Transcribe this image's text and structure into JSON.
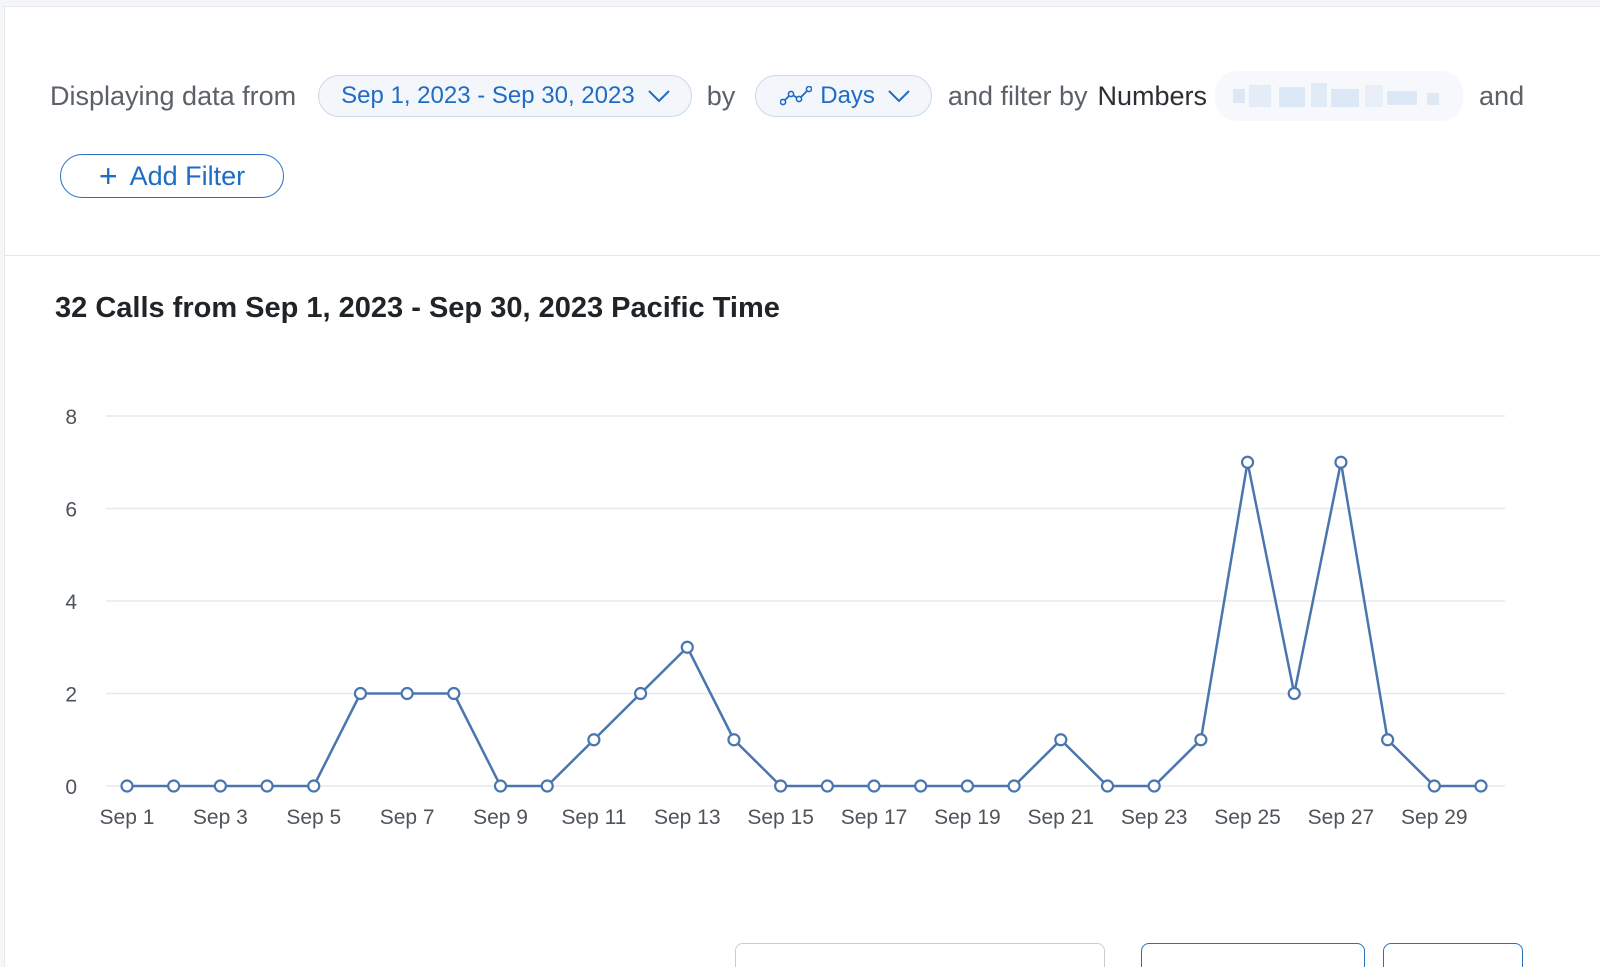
{
  "filter_bar": {
    "label_from": "Displaying data from",
    "date_range": "Sep 1, 2023 - Sep 30, 2023",
    "label_by": "by",
    "granularity": "Days",
    "label_filter_by": "and filter by",
    "filter_field": "Numbers",
    "label_and": "and",
    "add_filter": "Add Filter",
    "icons": {
      "dropdown": "chevron-down-icon",
      "granularity": "line-chart-icon",
      "add": "plus-icon"
    }
  },
  "chart_title": "32 Calls from Sep 1, 2023 - Sep 30, 2023 Pacific Time",
  "chart_data": {
    "type": "line",
    "x": [
      "Sep 1",
      "Sep 2",
      "Sep 3",
      "Sep 4",
      "Sep 5",
      "Sep 6",
      "Sep 7",
      "Sep 8",
      "Sep 9",
      "Sep 10",
      "Sep 11",
      "Sep 12",
      "Sep 13",
      "Sep 14",
      "Sep 15",
      "Sep 16",
      "Sep 17",
      "Sep 18",
      "Sep 19",
      "Sep 20",
      "Sep 21",
      "Sep 22",
      "Sep 23",
      "Sep 24",
      "Sep 25",
      "Sep 26",
      "Sep 27",
      "Sep 28",
      "Sep 29",
      "Sep 30"
    ],
    "x_tick_labels": [
      "Sep 1",
      "Sep 3",
      "Sep 5",
      "Sep 7",
      "Sep 9",
      "Sep 11",
      "Sep 13",
      "Sep 15",
      "Sep 17",
      "Sep 19",
      "Sep 21",
      "Sep 23",
      "Sep 25",
      "Sep 27",
      "Sep 29"
    ],
    "series": [
      {
        "values": [
          0,
          0,
          0,
          0,
          0,
          2,
          2,
          2,
          0,
          0,
          1,
          2,
          3,
          1,
          0,
          0,
          0,
          0,
          0,
          0,
          1,
          0,
          0,
          1,
          7,
          2,
          7,
          1,
          0,
          0
        ]
      }
    ],
    "y_ticks": [
      0,
      2,
      4,
      6,
      8
    ],
    "ylim": [
      0,
      8
    ],
    "grid": true,
    "colors": {
      "line": "#4a76b0",
      "grid": "#e6e9ed",
      "point_fill": "#ffffff"
    }
  }
}
